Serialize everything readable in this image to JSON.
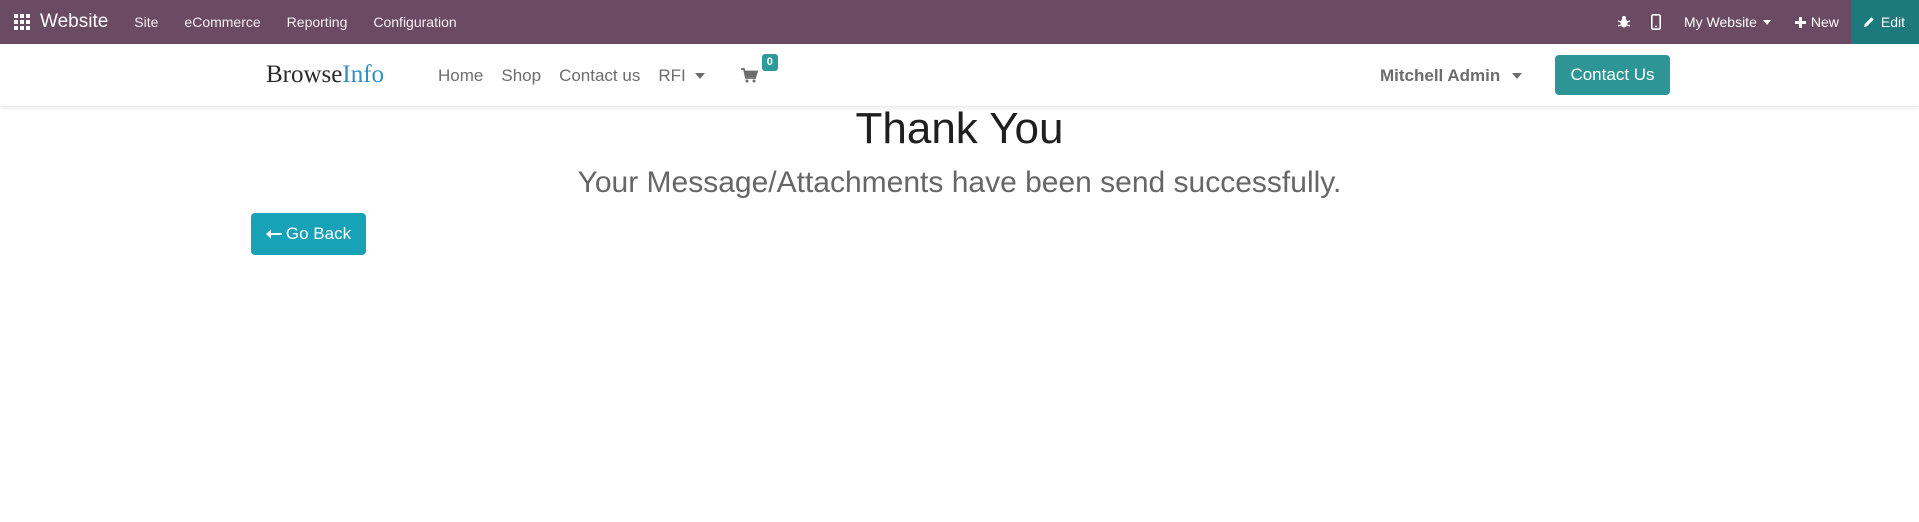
{
  "admin_bar": {
    "app_title": "Website",
    "menu": [
      "Site",
      "eCommerce",
      "Reporting",
      "Configuration"
    ],
    "website_selector": "My Website",
    "new_label": "New",
    "edit_label": "Edit",
    "icons": {
      "apps": "apps-grid-icon",
      "debug": "bug-icon",
      "mobile": "mobile-icon",
      "new": "plus-icon",
      "edit": "pencil-icon"
    },
    "colors": {
      "bar": "#6b4a63",
      "edit": "#1c7a7d"
    }
  },
  "header": {
    "logo_part1": "Browse",
    "logo_part2": "Info",
    "nav": [
      "Home",
      "Shop",
      "Contact us"
    ],
    "dropdown_label": "RFI",
    "cart_count": "0",
    "user_name": "Mitchell Admin",
    "contact_button": "Contact Us",
    "colors": {
      "accent": "#2e9597",
      "logo_accent": "#2f8fc7"
    }
  },
  "main": {
    "title": "Thank You",
    "subtitle": "Your Message/Attachments have been send successfully.",
    "go_back_label": "Go Back",
    "go_back_color": "#17a2b8"
  }
}
